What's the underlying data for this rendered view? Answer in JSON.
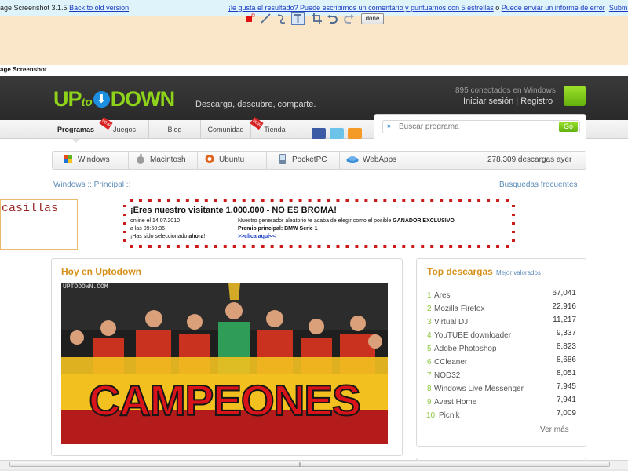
{
  "extension": {
    "title": "age Screenshot 3.1.5",
    "back_link": "Back to old version",
    "feedback_link": "¡le gusta el resultado? Puede escribirnos un comentario y puntuarnos con 5 estrellas",
    "or_text": " o ",
    "error_link": "Puede enviar un informe de error",
    "suggest_link": "Submit sugge",
    "done_label": "done",
    "tools": [
      "red-square-icon",
      "line-icon",
      "curve-icon",
      "text-icon",
      "crop-icon",
      "undo-icon",
      "redo-icon"
    ],
    "image_label": "age Screenshot"
  },
  "site": {
    "logo": {
      "up": "UP",
      "to": "to",
      "down": "DOWN"
    },
    "tagline": "Descarga, descubre, comparte.",
    "online": "895 conectados en Windows",
    "login": "Iniciar sesión",
    "separator": " | ",
    "register": "Registro"
  },
  "nav": {
    "items": [
      "Programas",
      "Juegos",
      "Blog",
      "Comunidad",
      "Tienda"
    ],
    "new_tag": "NEW"
  },
  "search": {
    "placeholder": "Buscar programa",
    "chevron": "»",
    "go": "Go"
  },
  "platforms": {
    "items": [
      "Windows",
      "Macintosh",
      "Ubuntu",
      "PocketPC",
      "WebApps"
    ],
    "downloads_yesterday": "278.309 descargas ayer"
  },
  "breadcrumb": "Windows :: Principal ::",
  "busquedas": "Busquedas frecuentes",
  "casillas": "casillas",
  "banner": {
    "title": "¡Eres nuestro visitante 1.000.000 - NO ES BROMA!",
    "left_line1": "online el 14.07.2010",
    "left_line2": "a las 09:50:35",
    "left_line3_pre": "¡Has sido seleccionado ",
    "left_line3_bold": "ahora",
    "left_line3_post": "!",
    "right_line1_pre": "Nuestro generador aleatorio te acaba de elegir como el posible ",
    "right_line1_bold": "GANADOR EXCLUSIVO",
    "right_line2": "Premio principal: BMW Serie 1",
    "link": ">>clica aquí<<"
  },
  "hoy": {
    "title": "Hoy en Uptodown",
    "watermark": "UPTODOWN.COM",
    "caption": "CAMPEONES"
  },
  "top": {
    "title": "Top descargas",
    "tab2": "Mejor valorados",
    "items": [
      {
        "rank": "1",
        "name": "Ares",
        "count": "67,041"
      },
      {
        "rank": "2",
        "name": "Mozilla Firefox",
        "count": "22,916"
      },
      {
        "rank": "3",
        "name": "Virtual DJ",
        "count": "11,217"
      },
      {
        "rank": "4",
        "name": "YouTUBE downloader",
        "count": "9,337"
      },
      {
        "rank": "5",
        "name": "Adobe Photoshop",
        "count": "8,823"
      },
      {
        "rank": "6",
        "name": "CCleaner",
        "count": "8,686"
      },
      {
        "rank": "7",
        "name": "NOD32",
        "count": "8,051"
      },
      {
        "rank": "8",
        "name": "Windows Live Messenger",
        "count": "7,945"
      },
      {
        "rank": "9",
        "name": "Avast Home",
        "count": "7,941"
      },
      {
        "rank": "10",
        "name": "Picnik",
        "count": "7,009"
      }
    ],
    "more": "Ver más"
  },
  "colors": {
    "accent_green": "#8ed21a",
    "section_title": "#d6901a",
    "banner_red": "#cc1a1a",
    "link_blue": "#1a3cc5"
  }
}
